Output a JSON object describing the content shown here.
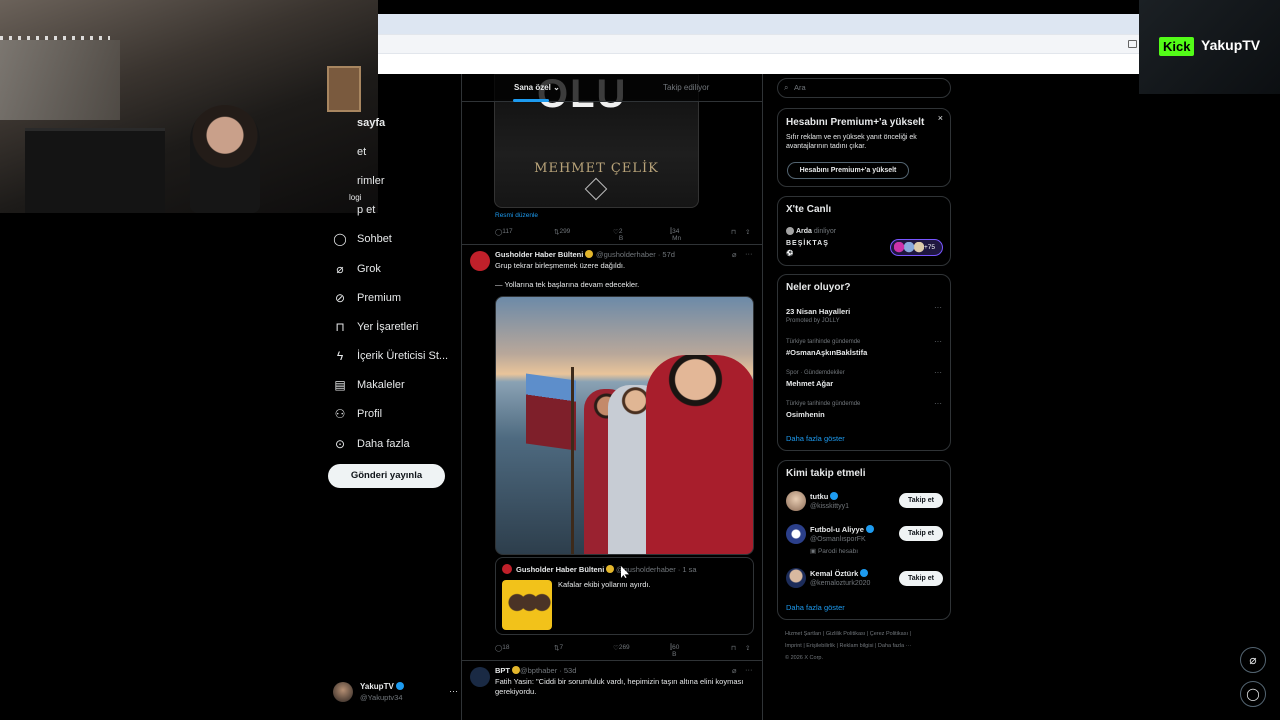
{
  "overlay": {
    "kick_badge": "Kick",
    "channel_name": "YakupTV",
    "webcam_label": "logi"
  },
  "nav": {
    "items": [
      {
        "label": "sayfa",
        "icon": "home-icon",
        "bold": true
      },
      {
        "label": "et",
        "icon": "search-icon"
      },
      {
        "label": "rimler",
        "icon": "bell-icon"
      },
      {
        "label": "p et",
        "icon": "envelope-icon"
      },
      {
        "label": "Sohbet",
        "icon": "chat-icon"
      },
      {
        "label": "Grok",
        "icon": "grok-icon"
      },
      {
        "label": "Premium",
        "icon": "premium-icon"
      },
      {
        "label": "Yer İşaretleri",
        "icon": "bookmark-icon"
      },
      {
        "label": "İçerik Üreticisi St...",
        "icon": "lightning-icon"
      },
      {
        "label": "Makaleler",
        "icon": "article-icon"
      },
      {
        "label": "Profil",
        "icon": "person-icon"
      },
      {
        "label": "Daha fazla",
        "icon": "more-circle-icon"
      }
    ],
    "post_button": "Gönderi yayınla",
    "profile": {
      "name": "YakupTV",
      "handle": "@Yakuptv34",
      "more": "···"
    }
  },
  "feed": {
    "tabs": [
      "Sana özel",
      "Takip ediliyor"
    ],
    "book": {
      "title_partial": "OLU",
      "author": "MEHMET ÇELİK"
    },
    "edit_link": "Resmi düzenle",
    "post1_actions": {
      "replies": "117",
      "reposts": "299",
      "likes": "2 B",
      "views": "34 Mn"
    },
    "post2": {
      "name": "Gusholder Haber Bülteni",
      "handle": "@gusholderhaber · 57d",
      "line1": "Grup tekrar birleşmemek üzere dağıldı.",
      "line2": "— Yollarına tek başlarına devam edecekler.",
      "quote": {
        "name": "Gusholder Haber Bülteni",
        "handle": "@gusholderhaber · 1 sa",
        "text": "Kafalar ekibi yollarını ayırdı."
      },
      "actions": {
        "replies": "18",
        "reposts": "7",
        "likes": "269",
        "views": "60 B"
      }
    },
    "post3": {
      "name": "BPT",
      "handle": "@bpthaber · 53d",
      "text": "Fatih Yasin: \"Ciddi bir sorumluluk vardı, hepimizin taşın altına elini koyması gerekiyordu."
    }
  },
  "sidebar": {
    "search_placeholder": "Ara",
    "premium": {
      "title": "Hesabını Premium+'a yükselt",
      "text": "Sıfır reklam ve en yüksek yanıt önceliği ek avantajlarının tadını çıkar.",
      "button": "Hesabını Premium+'a yükselt"
    },
    "live": {
      "title": "X'te Canlı",
      "host": "Arda",
      "host_status": "dinliyor",
      "topic": "BEŞİKTAŞ",
      "count": "+75"
    },
    "trends": {
      "title": "Neler oluyor?",
      "items": [
        {
          "meta": "",
          "title": "23 Nisan Hayalleri",
          "sub": "Promoted by JOLLY"
        },
        {
          "meta": "Türkiye tarihinde gündemde",
          "title": "#OsmanAşkınBakİstifa",
          "sub": ""
        },
        {
          "meta": "Spor · Gündemdekiler",
          "title": "Mehmet Ağar",
          "sub": ""
        },
        {
          "meta": "Türkiye tarihinde gündemde",
          "title": "Osimhenin",
          "sub": ""
        }
      ],
      "more": "Daha fazla göster"
    },
    "who_to_follow": {
      "title": "Kimi takip etmeli",
      "items": [
        {
          "name": "tutku",
          "handle": "@kisskittyy1",
          "note": "",
          "button": "Takip et"
        },
        {
          "name": "Futbol-u Aliyye",
          "handle": "@OsmanlısporFK",
          "note": "Parodi hesabı",
          "button": "Takip et"
        },
        {
          "name": "Kemal Öztürk",
          "handle": "@kemalozturk2020",
          "note": "",
          "button": "Takip et"
        }
      ],
      "more": "Daha fazla göster"
    },
    "footer": {
      "line1": "Hizmet Şartları | Gizlilik Politikası | Çerez Politikası |",
      "line2": "Imprint | Erişilebilirlik | Reklam bilgisi | Daha fazla ···",
      "line3": "© 2026 X Corp."
    }
  }
}
